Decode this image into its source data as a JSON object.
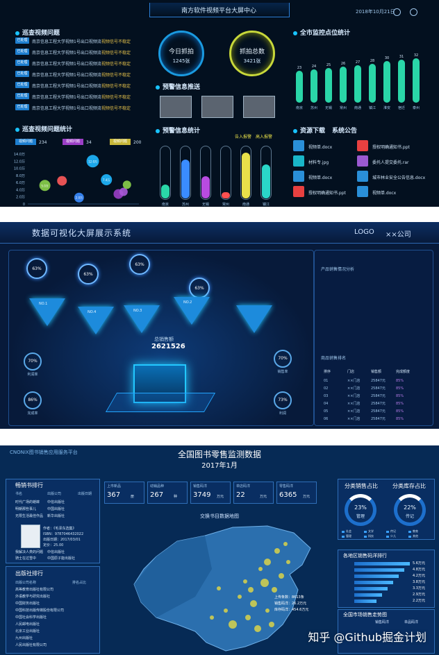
{
  "p1": {
    "title": "南方软件视频平台大屏中心",
    "date": "2018年10月21日",
    "left_title": "巡查视频问题",
    "rows": [
      {
        "tag": "已处理",
        "text": "南京信息工程大学视频1号出口视频流",
        "status": "视频信号不稳定"
      },
      {
        "tag": "已处理",
        "text": "南京信息工程大学视频1号出口视频流",
        "status": "视频信号不稳定"
      },
      {
        "tag": "已处理",
        "text": "南京信息工程大学视频1号出口视频流",
        "status": "视频信号不稳定"
      },
      {
        "tag": "已处理",
        "text": "南京信息工程大学视频1号出口视频流",
        "status": "视频信号不稳定"
      },
      {
        "tag": "已处理",
        "text": "南京信息工程大学视频1号出口视频流",
        "status": "视频信号不稳定"
      },
      {
        "tag": "已处理",
        "text": "南京信息工程大学视频1号出口视频流",
        "status": "视频信号不稳定"
      },
      {
        "tag": "已处理",
        "text": "南京信息工程大学视频1号出口视频流",
        "status": "视频信号不稳定"
      }
    ],
    "stats_title": "巡查视频问题统计",
    "stats_items": [
      {
        "label": "视频问题",
        "value": "234",
        "color": "#1e7fd0"
      },
      {
        "label": "视频问题",
        "value": "34",
        "color": "#9b3fc6"
      },
      {
        "label": "视频问题",
        "value": "200",
        "color": "#c8b83a"
      }
    ],
    "capture_today": {
      "label": "今日抓拍",
      "value": "1245张"
    },
    "capture_total": {
      "label": "抓拍总数",
      "value": "3421张"
    },
    "push_title": "预警信息推送",
    "warn_title": "预警信息统计",
    "warn_legend": [
      "告入报警",
      "高入报警"
    ],
    "tube_labels": [
      "南京",
      "苏州",
      "无锡",
      "常州",
      "南通",
      "镇江"
    ],
    "tube_levels": [
      0.28,
      0.78,
      0.45,
      0.12,
      0.92,
      0.68
    ],
    "tube_colors": [
      "#2ad6a8",
      "#3a8cff",
      "#b84be0",
      "#ff5050",
      "#e8e04a",
      "#2ad6c8"
    ],
    "right_title": "全市监控点位统计",
    "bar_categories": [
      "南京",
      "苏州",
      "无锡",
      "常州",
      "南通",
      "镇江",
      "淮安",
      "宿迁",
      "泰州"
    ],
    "bar_values": [
      23,
      24,
      25,
      26,
      27,
      28,
      30,
      31,
      32
    ],
    "bar_ymax": 36,
    "res_title": "资源下载",
    "res_title2": "系统公告",
    "docs": [
      {
        "name": "视频单.docx",
        "color": "#2a8fd8"
      },
      {
        "name": "授权明确通知书.ppt",
        "color": "#e84040"
      },
      {
        "name": "材料专.jpg",
        "color": "#19b6c8"
      },
      {
        "name": "委托人提交委托.rar",
        "color": "#9b59d0"
      },
      {
        "name": "视频单.docx",
        "color": "#2a8fd8"
      },
      {
        "name": "城市林业安全公告信息.docx",
        "color": "#2a8fd8"
      },
      {
        "name": "授权明确通知书.ppt",
        "color": "#e84040"
      },
      {
        "name": "视频单.docx",
        "color": "#2a8fd8"
      }
    ],
    "chart_data": {
      "type": "scatter",
      "yticks": [
        "14.0万",
        "12.0万",
        "10.0万",
        "8.0万",
        "6.0万",
        "4.0万",
        "2.0万",
        "0"
      ],
      "ylim": [
        0,
        14
      ],
      "points": [
        {
          "x": 1,
          "y": 5.2,
          "r": 8,
          "color": "#8bd14a",
          "label": "5.0万"
        },
        {
          "x": 2,
          "y": 6.5,
          "r": 7,
          "color": "#ff5a5a",
          "label": ""
        },
        {
          "x": 3,
          "y": 1.8,
          "r": 7,
          "color": "#3a8cff",
          "label": "2.0万"
        },
        {
          "x": 3.8,
          "y": 12.0,
          "r": 9,
          "color": "#1fb8ff",
          "label": "12.0万"
        },
        {
          "x": 4.6,
          "y": 6.8,
          "r": 8,
          "color": "#1fb8ff",
          "label": "7.4万"
        },
        {
          "x": 5.3,
          "y": 2.8,
          "r": 7,
          "color": "#9b3fc6",
          "label": ""
        },
        {
          "x": 5.6,
          "y": 3.4,
          "r": 6,
          "color": "#a85ad8",
          "label": ""
        },
        {
          "x": 5.8,
          "y": 5.4,
          "r": 6,
          "color": "#8bd14a",
          "label": ""
        }
      ]
    }
  },
  "p2": {
    "title": "数据可视化大屏展示系统",
    "logo": "LOGO",
    "company": "××公司",
    "rings": [
      {
        "pct": "63%"
      },
      {
        "pct": "63%"
      },
      {
        "pct": "63%"
      },
      {
        "pct": "63%"
      }
    ],
    "nodes": [
      "NO.1",
      "NO.4",
      "NO.3",
      "NO.2",
      ""
    ],
    "total_label": "总销售额",
    "total_value": "2621526",
    "left_stats": [
      {
        "pct": "70%",
        "label": "利润率"
      },
      {
        "pct": "86%",
        "label": "完成率"
      }
    ],
    "right_stats": [
      {
        "pct": "70%",
        "label": "销售率"
      },
      {
        "pct": "73%",
        "label": "利润"
      }
    ],
    "right_title1": "产品销售情况分析",
    "right_title2": "商品销售排名",
    "table_headers": [
      "排序",
      "门店",
      "销售额",
      "完成额度"
    ],
    "table_rows": [
      [
        "01",
        "××门店",
        "25847元",
        "85%"
      ],
      [
        "02",
        "××门店",
        "25847元",
        "85%"
      ],
      [
        "03",
        "××门店",
        "25847元",
        "85%"
      ],
      [
        "04",
        "××门店",
        "25847元",
        "85%"
      ],
      [
        "05",
        "××门店",
        "25847元",
        "85%"
      ],
      [
        "06",
        "××门店",
        "25847元",
        "85%"
      ]
    ]
  },
  "p3": {
    "brand": "CNONIX图书销售应用服务平台",
    "title": "全国图书零售监测数据",
    "subtitle": "2017年1月",
    "kpis": [
      {
        "label": "上市新品",
        "value": "367",
        "unit": "册"
      },
      {
        "label": "动销品种",
        "value": "267",
        "unit": "种"
      },
      {
        "label": "销售码洋",
        "value": "3749",
        "unit": "万元"
      },
      {
        "label": "单店码洋",
        "value": "22",
        "unit": "万元"
      },
      {
        "label": "零售码洋",
        "value": "6365",
        "unit": "万元"
      }
    ],
    "map_title": "交换书目数据地图",
    "rank_title": "畅销书排行",
    "rank_headers": [
      "书名",
      "出版公司",
      "出版日期"
    ],
    "rank_rows": [
      [
        "时代广场的蟋蟀",
        "中信出版社",
        ""
      ],
      [
        "明朝那些事儿",
        "中国出版社",
        ""
      ],
      [
        "无限生活最佳作品",
        "新华出版社",
        ""
      ]
    ],
    "book_info": [
      "作者：《毛泽东选集》",
      "ISBN：9787046432022",
      "出版日期：2017/03/01",
      "定价：25.00"
    ],
    "rank_rows2": [
      [
        "我解决人类的问题",
        "中信出版社",
        ""
      ],
      [
        "骑士在过雪中",
        "中国原子能出版社",
        ""
      ]
    ],
    "pub_title": "出版社排行",
    "pub_header": [
      "出版公司名称",
      "排名占比"
    ],
    "publishers": [
      "高等教育出版社有限公司",
      "外语教学与研究出版社",
      "中国财务出版社",
      "中国科技出版传媒股份有限公司",
      "中国社会科学出版社",
      "人民邮电出版社",
      "北京工业出版社",
      "九州出版社",
      "人民出版社有限公司"
    ],
    "map_info": [
      "上传条数：8613条",
      "销售码洋：26.2万元",
      "库存码洋：454.6万元"
    ],
    "donut1_title": "分类销售占比",
    "donut2_title": "分类库存占比",
    "donut1": {
      "pct": "23%",
      "label": "管理"
    },
    "donut2": {
      "pct": "22%",
      "label": "传记"
    },
    "legend_cats": [
      "社会",
      "文学",
      "传记",
      "教育",
      "管理",
      "科技",
      "少儿",
      "其他"
    ],
    "region_title": "各地区销售码洋排行",
    "region_vals": [
      "5.6万元",
      "4.8万元",
      "4.2万元",
      "3.8万元",
      "3.3万元",
      "2.9万元",
      "2.2万元"
    ],
    "trend_title": "全国市场销售走势图",
    "trend_legend": [
      "销售码洋",
      "单品码洋"
    ],
    "watermark": "知乎 @Github掘金计划"
  }
}
